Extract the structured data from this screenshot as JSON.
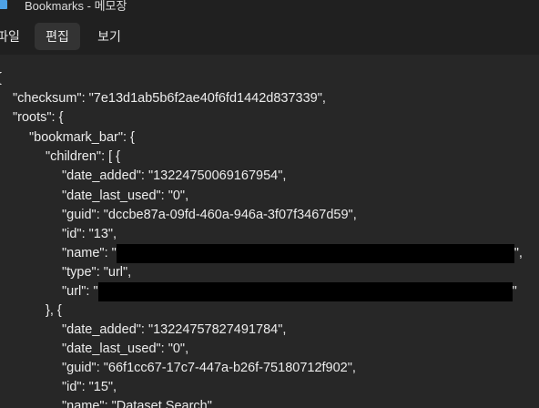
{
  "window": {
    "title": "Bookmarks - 메모장"
  },
  "menu": {
    "file": "파일",
    "edit": "편집",
    "view": "보기"
  },
  "editor": {
    "lines": [
      "{",
      "\"checksum\": \"7e13d1ab5b6f2ae40f6fd1442d837339\",",
      "\"roots\": {",
      "\"bookmark_bar\": {",
      "\"children\": [ {",
      "\"date_added\": \"13224750069167954\",",
      "\"date_last_used\": \"0\",",
      "\"guid\": \"dccbe87a-09fd-460a-946a-3f07f3467d59\",",
      "\"id\": \"13\",",
      "\"name\": \"",
      "\",",
      "\"type\": \"url\",",
      "\"url\": \"",
      "\"",
      "}, {",
      "\"date_added\": \"13224757827491784\",",
      "\"date_last_used\": \"0\",",
      "\"guid\": \"66f1cc67-17c7-447a-b26f-75180712f902\",",
      "\"id\": \"15\",",
      "\"name\": \"Dataset Search\","
    ]
  },
  "colors": {
    "background": "#272727",
    "chrome": "#202020",
    "text": "#ececec",
    "redaction": "#000000"
  }
}
